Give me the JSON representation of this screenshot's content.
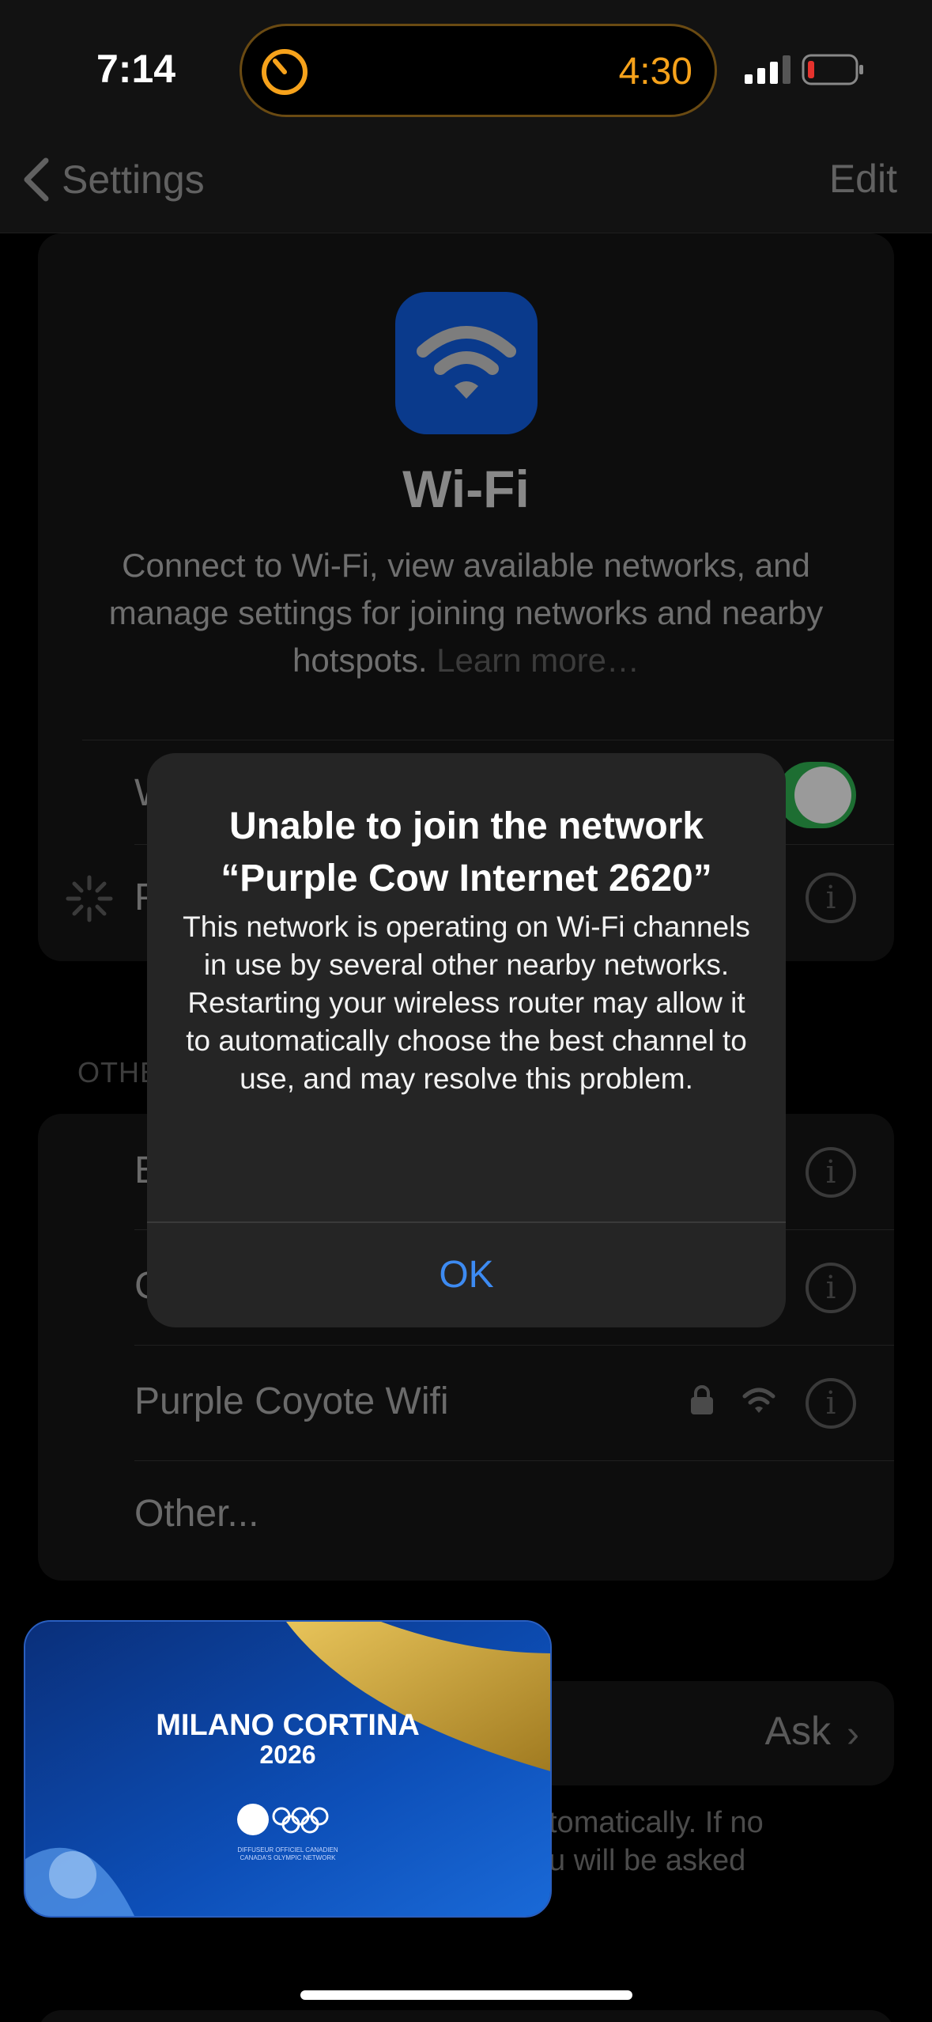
{
  "status_bar": {
    "time": "7:14",
    "live_activity_timer": "4:30"
  },
  "nav": {
    "back_label": "Settings",
    "edit_label": "Edit"
  },
  "wifi_header": {
    "title": "Wi-Fi",
    "description": "Connect to Wi-Fi, view available networks, and manage settings for joining networks and nearby hotspots.",
    "learn_more": "Learn more…"
  },
  "wifi_rows": {
    "toggle_row_partial": "W",
    "current_network_partial": "P"
  },
  "other_networks": {
    "section_label_partial": "OTHE",
    "items": [
      {
        "label": "E"
      },
      {
        "label": "C"
      },
      {
        "label": "Purple Coyote Wifi"
      },
      {
        "label": "Other..."
      }
    ]
  },
  "ask_row": {
    "value": "Ask",
    "footer_line1": "tomatically. If no",
    "footer_line2": "u will be asked"
  },
  "alert": {
    "title": "Unable to join the network “Purple Cow Internet 2620”",
    "message_line1": "This network is operating on Wi-Fi channels in use by several other nearby networks.",
    "message_line2": "Restarting your wireless router may allow it to automatically choose the best channel to use, and may resolve this problem.",
    "ok_label": "OK"
  },
  "pip": {
    "title": "MILANO CORTINA",
    "year": "2026",
    "small_text_1": "DIFFUSEUR OFFICIEL CANADIEN",
    "small_text_2": "CANADA'S OLYMPIC NETWORK"
  },
  "colors": {
    "accent": "#3d8bf2",
    "timer": "#f6a21b",
    "toggle_on": "#1d6e32"
  }
}
